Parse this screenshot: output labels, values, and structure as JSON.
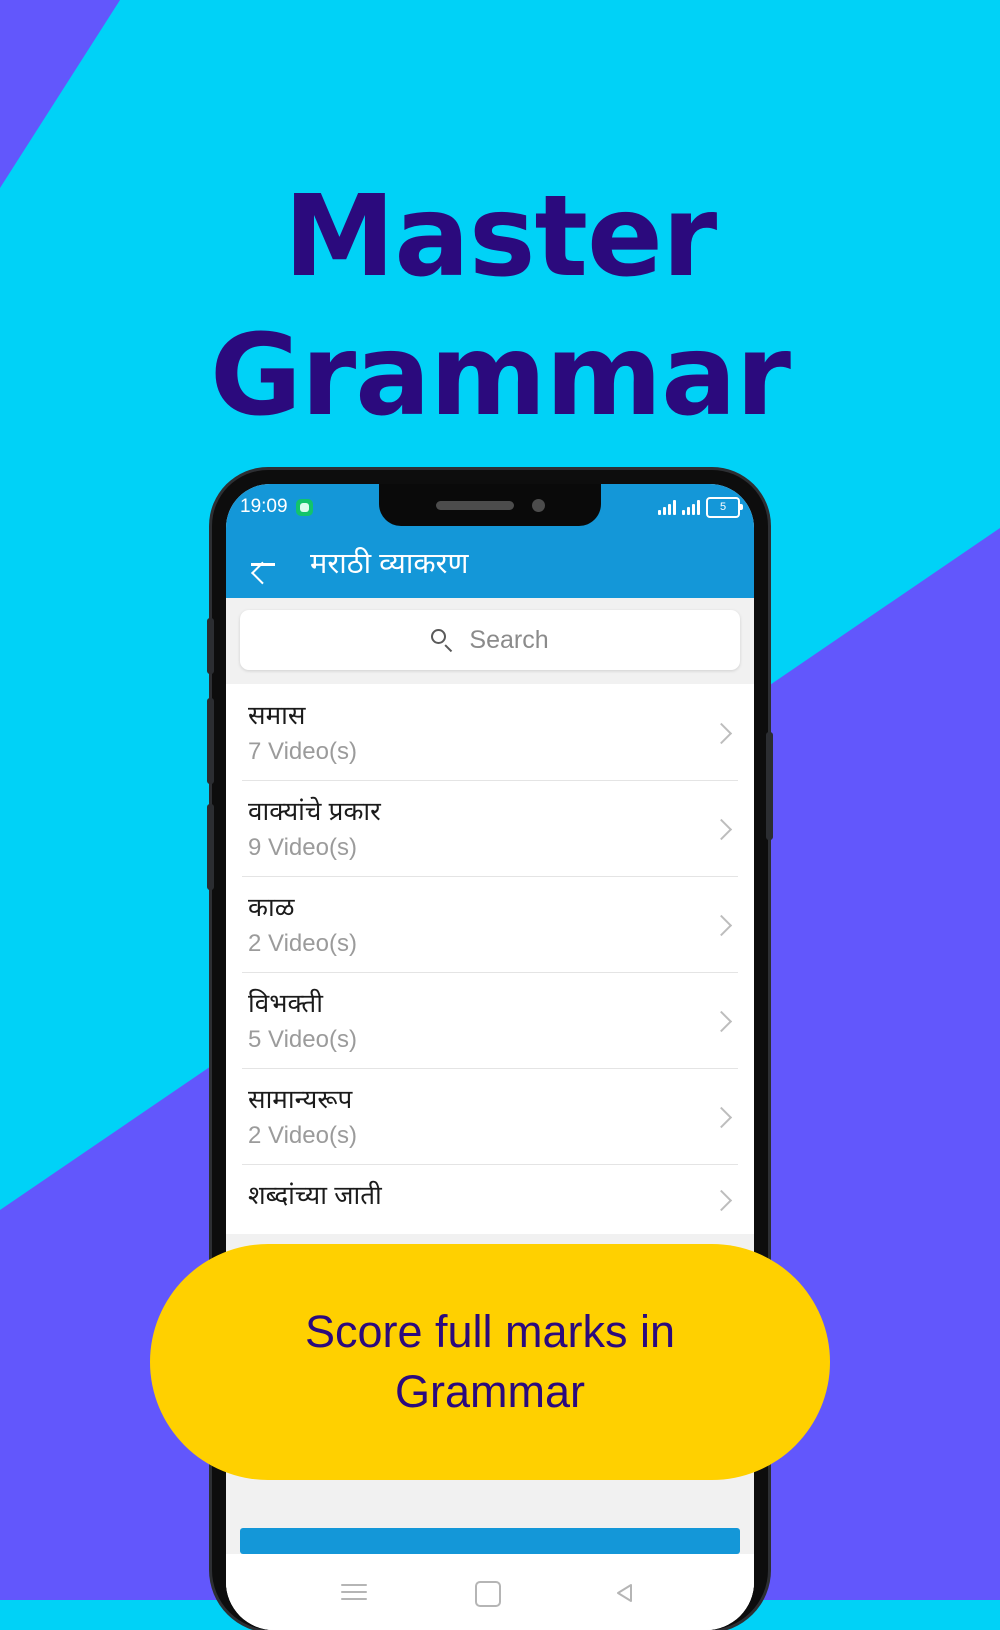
{
  "background": {
    "cyan": "#00d2f7",
    "purple": "#6257fc"
  },
  "headline": {
    "line1": "Master",
    "line2": "Grammar",
    "color": "#2b0a7d"
  },
  "promo_pill": {
    "line1": "Score full marks in",
    "line2": "Grammar",
    "background": "#ffd000",
    "text_color": "#2b0a7d"
  },
  "phone": {
    "status_bar": {
      "time": "19:09",
      "notification_icon": "message-icon",
      "signal_icon_1": "signal-bars-icon",
      "signal_icon_2": "signal-bars-icon",
      "battery_level": "5",
      "background": "#1497d8"
    },
    "app_bar": {
      "back_icon": "back-arrow-icon",
      "title": "मराठी व्याकरण",
      "background": "#1497d8"
    },
    "search": {
      "icon": "search-icon",
      "placeholder": "Search",
      "value": ""
    },
    "list": {
      "items": [
        {
          "title": "समास",
          "subtitle": "7 Video(s)",
          "chevron": "chevron-right-icon"
        },
        {
          "title": "वाक्यांचे प्रकार",
          "subtitle": "9 Video(s)",
          "chevron": "chevron-right-icon"
        },
        {
          "title": "काळ",
          "subtitle": "2 Video(s)",
          "chevron": "chevron-right-icon"
        },
        {
          "title": "विभक्ती",
          "subtitle": "5 Video(s)",
          "chevron": "chevron-right-icon"
        },
        {
          "title": "सामान्यरूप",
          "subtitle": "2 Video(s)",
          "chevron": "chevron-right-icon"
        },
        {
          "title": "शब्दांच्या जाती",
          "subtitle": "",
          "chevron": "chevron-right-icon"
        }
      ]
    },
    "nav_bar": {
      "recents": "menu-icon",
      "home": "home-square-icon",
      "back": "back-triangle-icon"
    }
  }
}
